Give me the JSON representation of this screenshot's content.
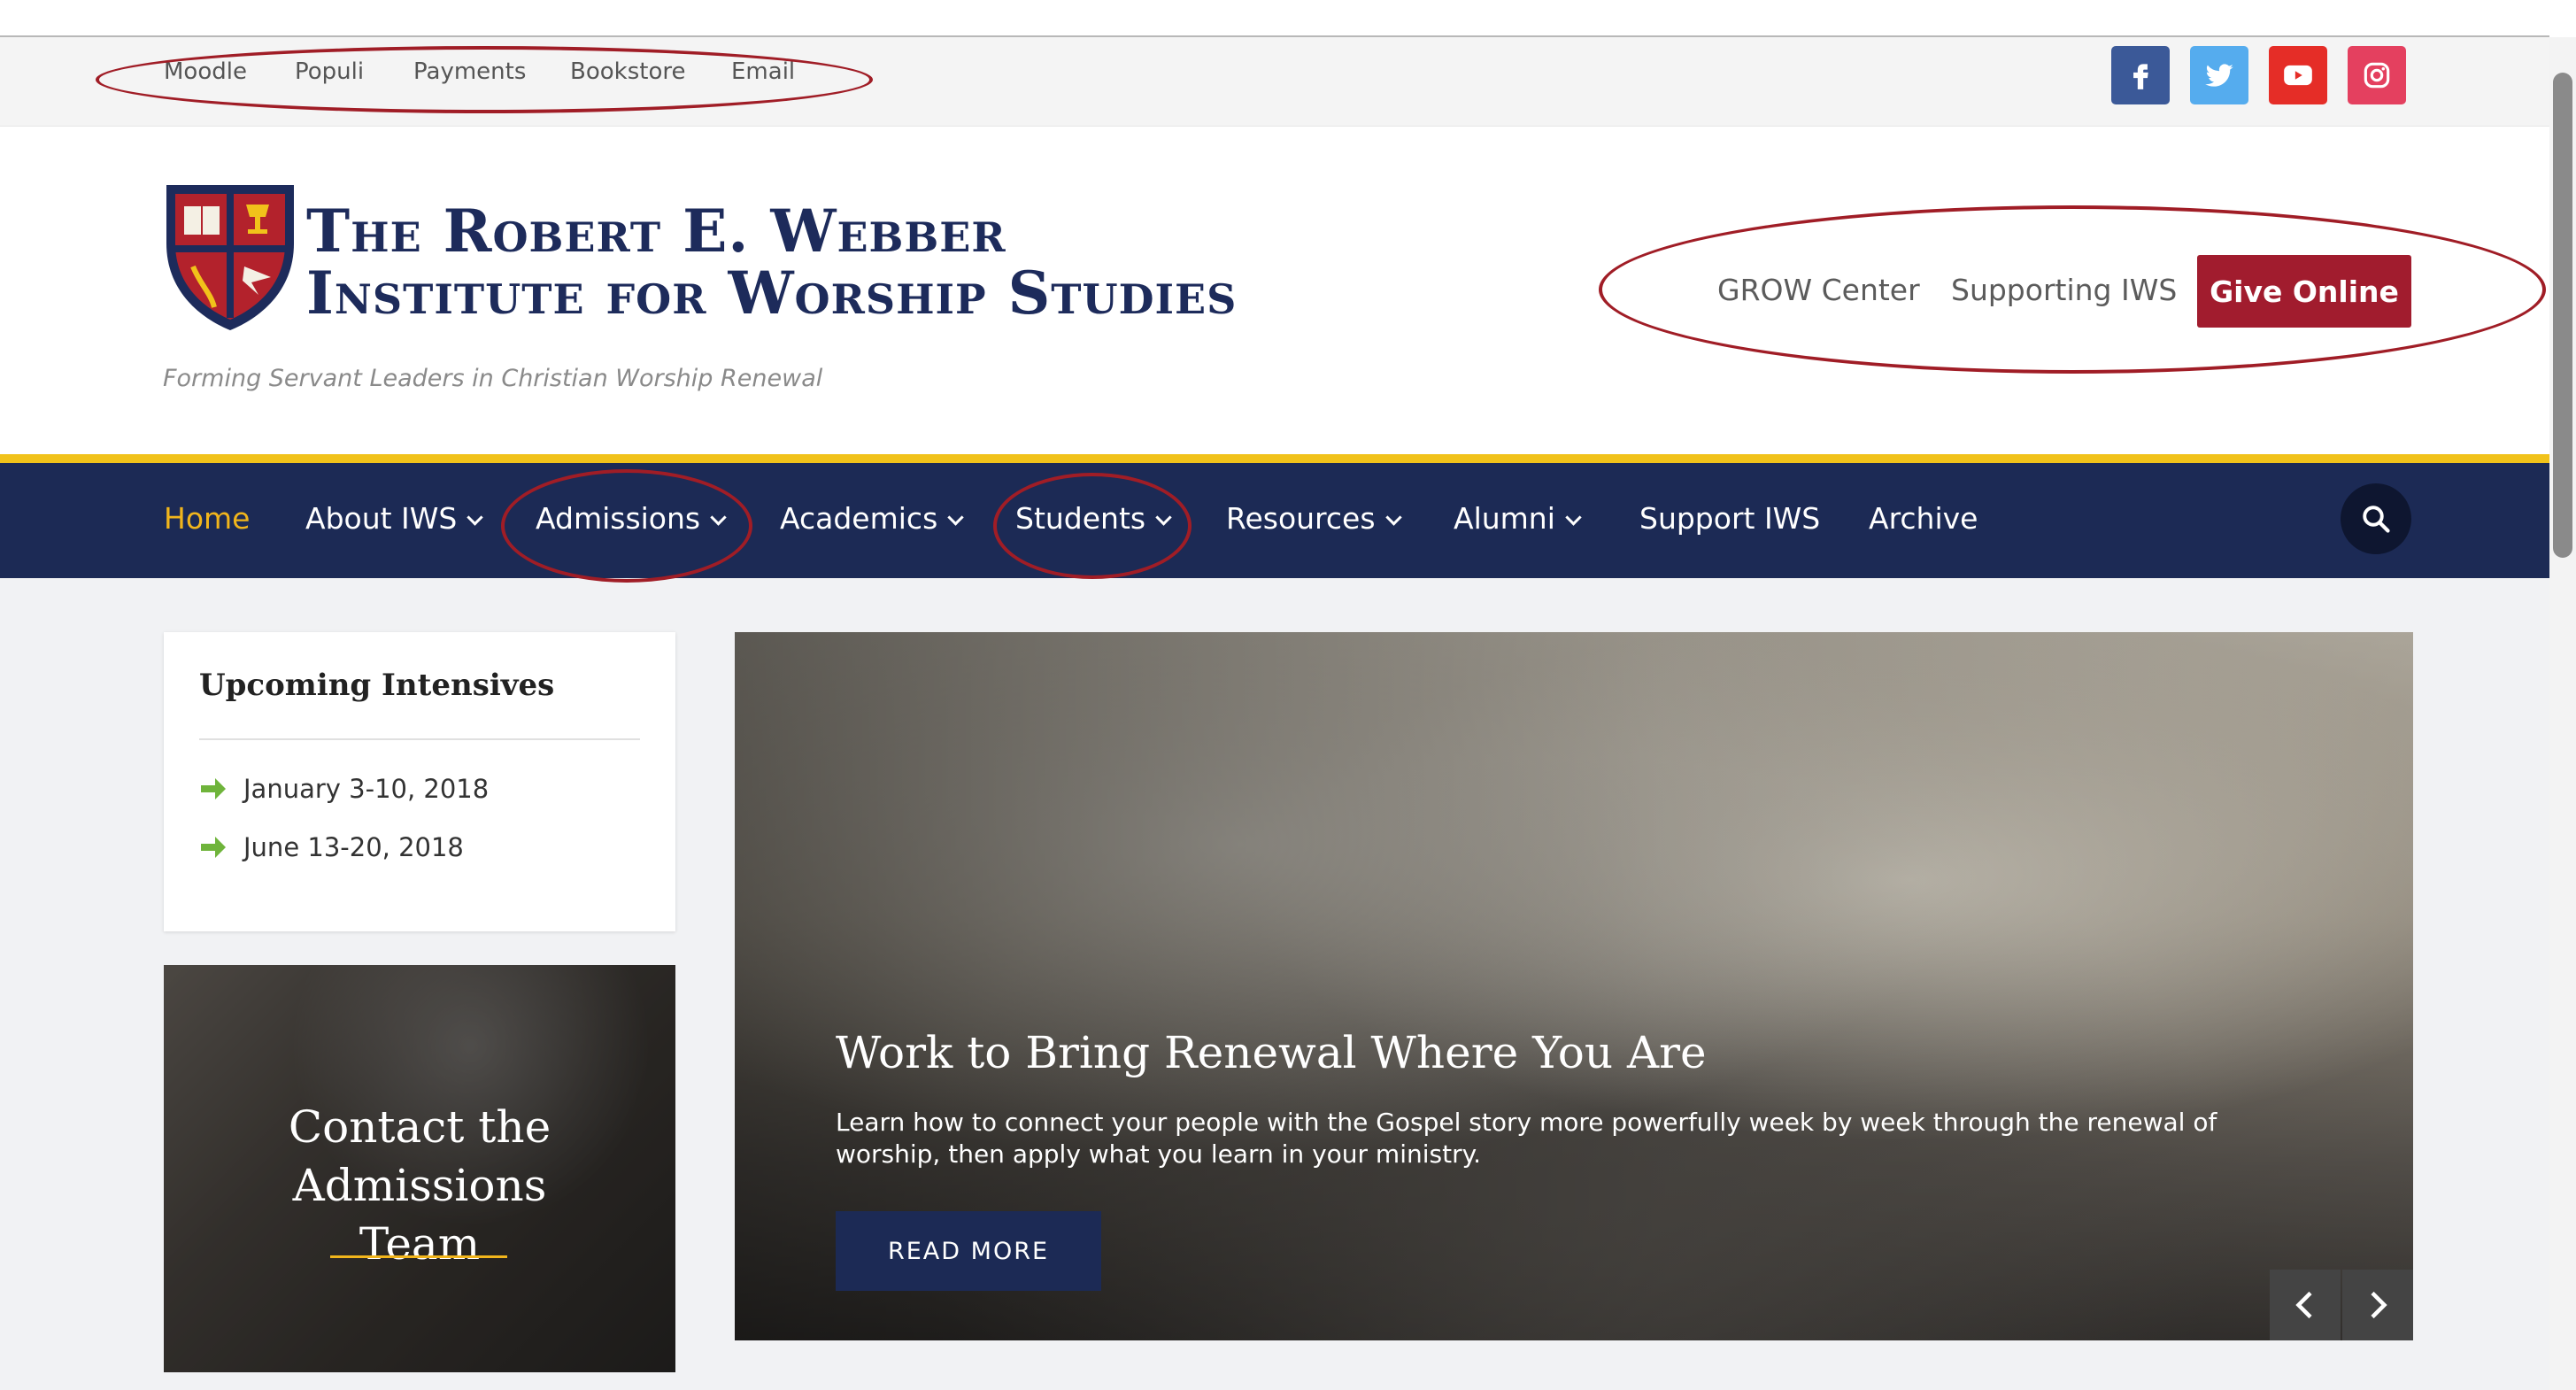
{
  "utility_nav": [
    "Moodle",
    "Populi",
    "Payments",
    "Bookstore",
    "Email"
  ],
  "social": [
    {
      "name": "facebook-icon",
      "color": "#3b5998"
    },
    {
      "name": "twitter-icon",
      "color": "#55acee"
    },
    {
      "name": "youtube-icon",
      "color": "#e52d27"
    },
    {
      "name": "instagram-icon",
      "color": "#e4405f"
    }
  ],
  "brand": {
    "line1": "The Robert E. Webber",
    "line2": "Institute for Worship Studies",
    "tagline": "Forming Servant Leaders in Christian Worship Renewal"
  },
  "header_links": {
    "grow": "GROW Center",
    "supporting": "Supporting IWS",
    "give": "Give Online"
  },
  "main_nav": [
    {
      "label": "Home",
      "active": true,
      "dropdown": false
    },
    {
      "label": "About IWS",
      "active": false,
      "dropdown": true
    },
    {
      "label": "Admissions",
      "active": false,
      "dropdown": true
    },
    {
      "label": "Academics",
      "active": false,
      "dropdown": true
    },
    {
      "label": "Students",
      "active": false,
      "dropdown": true
    },
    {
      "label": "Resources",
      "active": false,
      "dropdown": true
    },
    {
      "label": "Alumni",
      "active": false,
      "dropdown": true
    },
    {
      "label": "Support IWS",
      "active": false,
      "dropdown": false
    },
    {
      "label": "Archive",
      "active": false,
      "dropdown": false
    }
  ],
  "intensives": {
    "title": "Upcoming Intensives",
    "items": [
      "January 3-10, 2018",
      "June 13-20, 2018"
    ]
  },
  "admissions_card": {
    "line1": "Contact the Admissions",
    "line2": "Team"
  },
  "hero": {
    "title": "Work to Bring Renewal Where You Are",
    "text": "Learn how to connect your people with the Gospel story more powerfully week by week through the renewal of worship, then apply what you learn in your ministry.",
    "button": "READ MORE"
  },
  "colors": {
    "nav_bg": "#1c2a55",
    "accent_gold": "#f1c21a",
    "give_red": "#a11c2e",
    "annotation_red": "#a01d26"
  }
}
